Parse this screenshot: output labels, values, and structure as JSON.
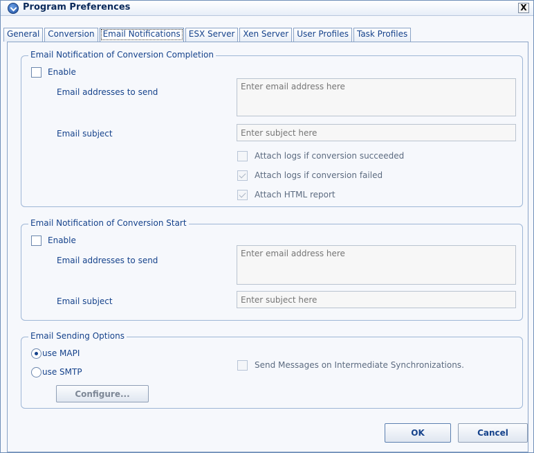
{
  "window": {
    "title": "Program Preferences",
    "close_label": "X"
  },
  "tabs": [
    {
      "label": "General"
    },
    {
      "label": "Conversion"
    },
    {
      "label": "Email Notifications"
    },
    {
      "label": "ESX Server"
    },
    {
      "label": "Xen Server"
    },
    {
      "label": "User Profiles"
    },
    {
      "label": "Task Profiles"
    }
  ],
  "completion": {
    "legend": "Email Notification of Conversion Completion",
    "enable_label": "Enable",
    "addresses_label": "Email addresses to send",
    "addresses_placeholder": "Enter email address here",
    "subject_label": "Email subject",
    "subject_placeholder": "Enter subject here",
    "attach_succeeded_label": "Attach logs if conversion succeeded",
    "attach_failed_label": "Attach logs if conversion failed",
    "attach_html_label": "Attach HTML report"
  },
  "start": {
    "legend": "Email Notification of Conversion Start",
    "enable_label": "Enable",
    "addresses_label": "Email addresses to send",
    "addresses_placeholder": "Enter email address here",
    "subject_label": "Email subject",
    "subject_placeholder": "Enter subject here"
  },
  "sending": {
    "legend": "Email Sending Options",
    "mapi_label": "use MAPI",
    "smtp_label": "use SMTP",
    "configure_label": "Configure...",
    "intermediate_label": "Send Messages on Intermediate Synchronizations."
  },
  "footer": {
    "ok_label": "OK",
    "cancel_label": "Cancel"
  }
}
